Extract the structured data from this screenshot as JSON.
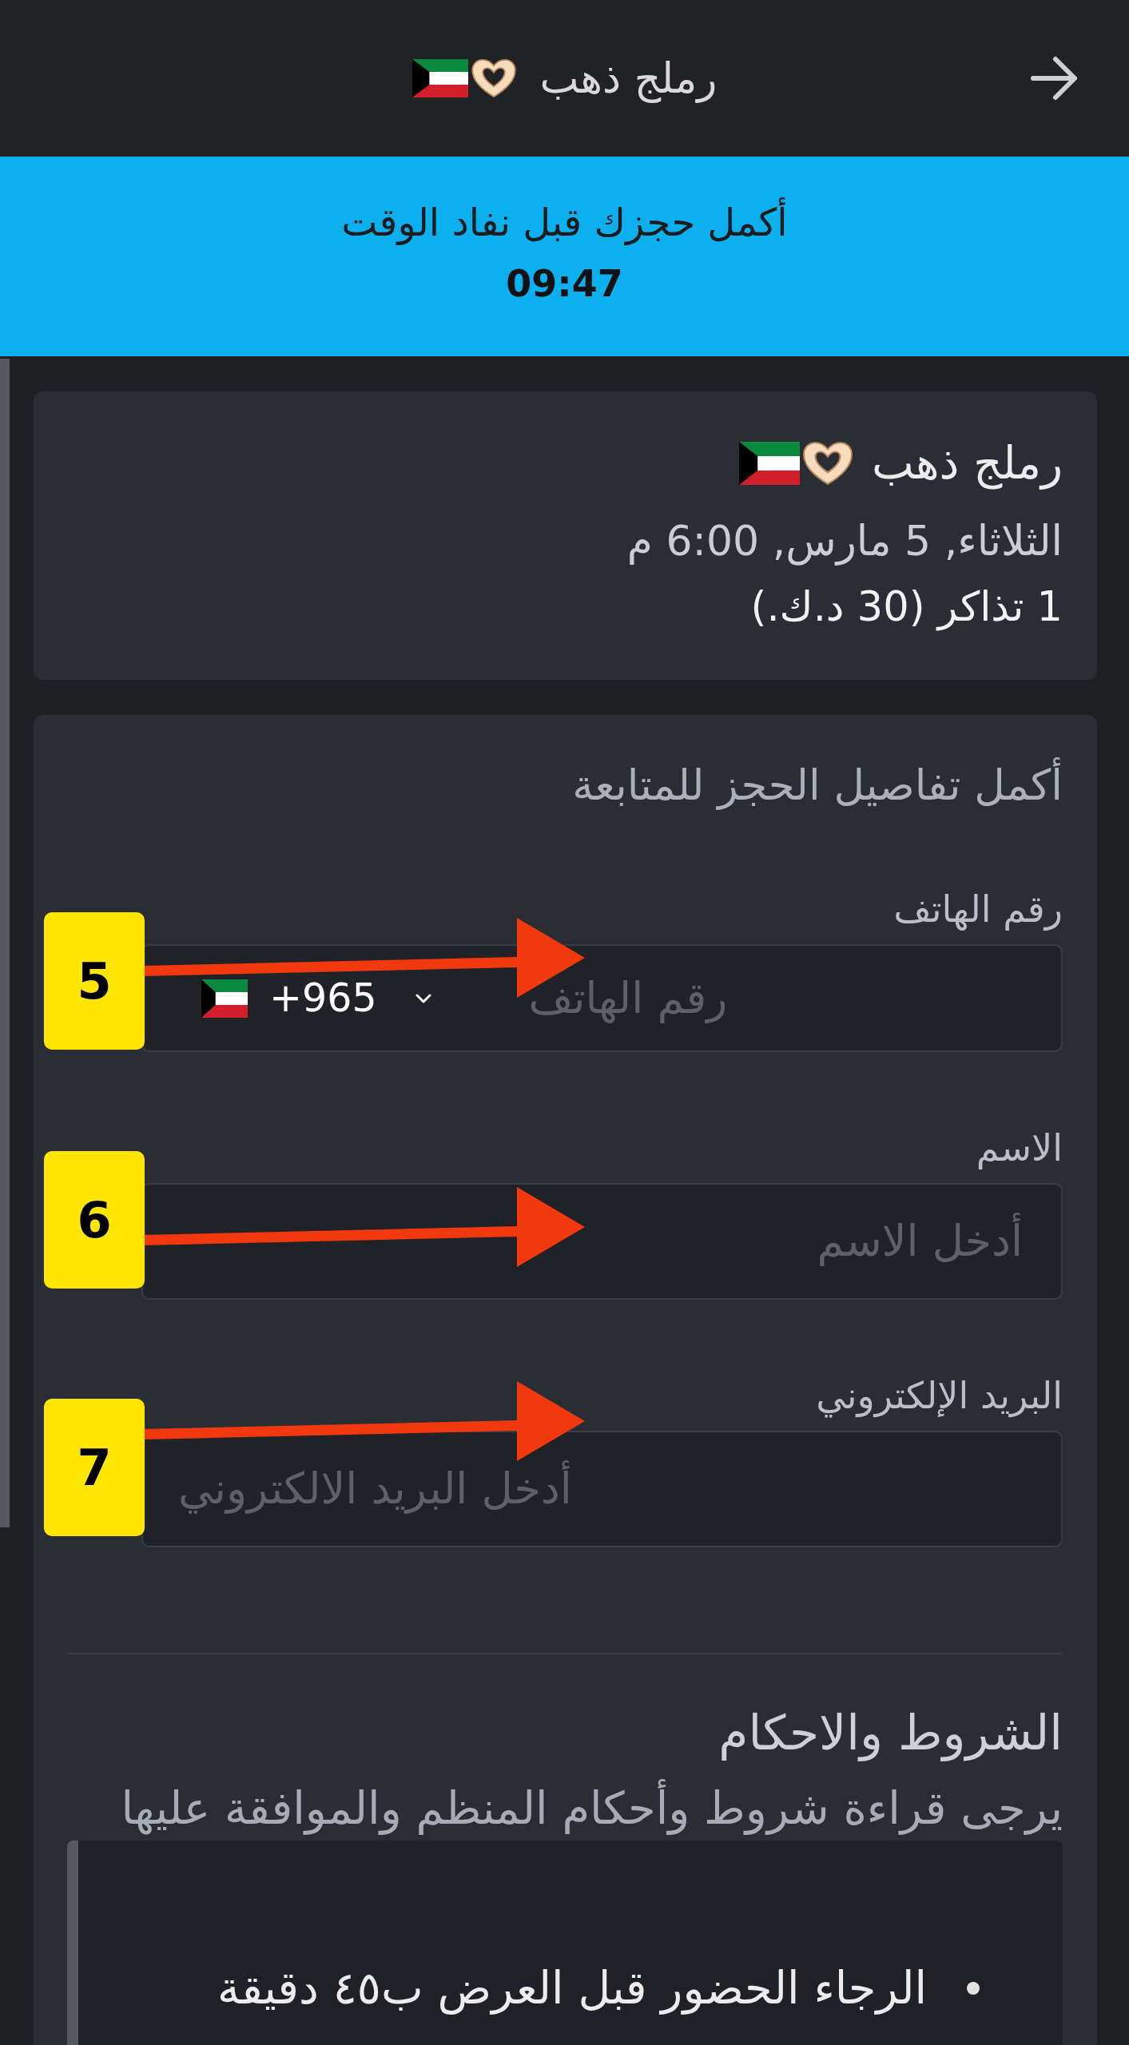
{
  "header": {
    "title": "رملج ذهب"
  },
  "timer_banner": {
    "message": "أكمل حجزك قبل نفاد الوقت",
    "time": "09:47"
  },
  "event_card": {
    "title": "رملج ذهب",
    "date": "الثلاثاء, 5 مارس, 6:00 م",
    "tickets": "1 تذاكر (30 د.ك.)"
  },
  "booking_form": {
    "heading": "أكمل تفاصيل الحجز للمتابعة",
    "fields": [
      {
        "kind": "phone",
        "label": "رقم الهاتف",
        "country_code": "+965",
        "placeholder": "رقم الهاتف",
        "step": "5"
      },
      {
        "kind": "name",
        "label": "الاسم",
        "placeholder": "أدخل الاسم",
        "step": "6"
      },
      {
        "kind": "email",
        "label": "البريد الإلكتروني",
        "placeholder": "أدخل البريد الالكتروني",
        "step": "7"
      }
    ]
  },
  "terms": {
    "title": "الشروط والاحكام",
    "subtitle": "يرجى قراءة شروط وأحكام المنظم والموافقة عليها",
    "items": [
      "الرجاء الحضور قبل العرض ب٤٥ دقيقة"
    ]
  }
}
